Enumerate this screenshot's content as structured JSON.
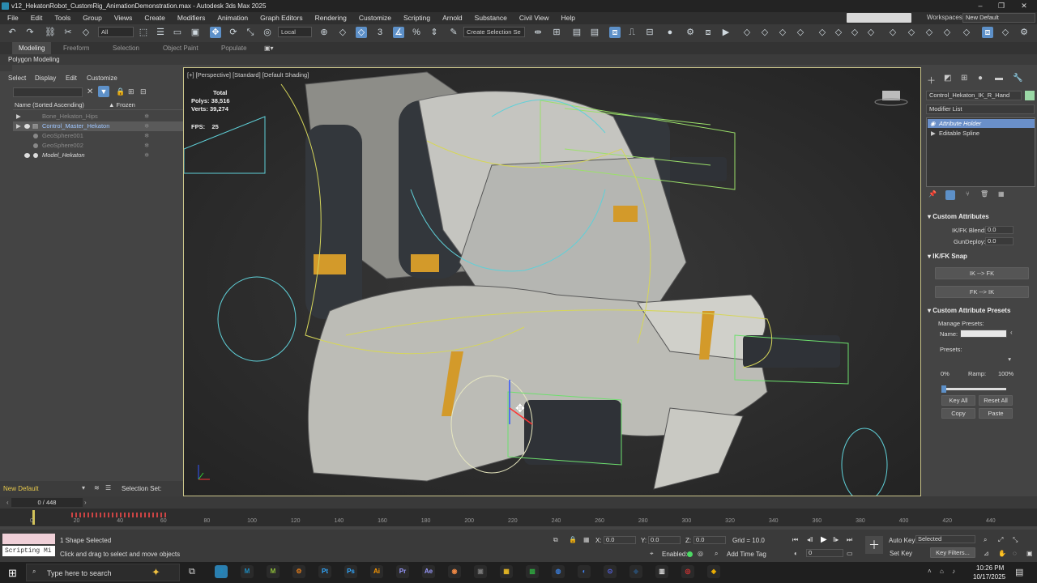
{
  "window": {
    "title": "v12_HekatonRobot_CustomRig_AnimationDemonstration.max - Autodesk 3ds Max 2025",
    "min": "–",
    "max": "❐",
    "close": "✕"
  },
  "menu": [
    "File",
    "Edit",
    "Tools",
    "Group",
    "Views",
    "Create",
    "Modifiers",
    "Animation",
    "Graph Editors",
    "Rendering",
    "Customize",
    "Scripting",
    "Arnold",
    "Substance",
    "Civil View",
    "Help"
  ],
  "workspace": {
    "label": "Workspaces:",
    "value": "New Default"
  },
  "toolbar": {
    "filter": "All",
    "coord": "Local",
    "selection_set": "Create Selection Se",
    "icons": {
      "undo": "↶",
      "redo": "↷",
      "link": "⛓",
      "unlink": "✂",
      "select": "⬚",
      "select_by_name": "☰",
      "rect_select": "▭",
      "window_cross": "▣",
      "move": "✥",
      "rotate": "⟳",
      "scale": "⤡",
      "place": "◎",
      "pivot": "⊕",
      "snap3": "3",
      "angle_snap": "∡",
      "percent_snap": "%",
      "spinner_snap": "⇕",
      "named_sel": "✎",
      "mirror": "⇹",
      "align": "⊞",
      "layer": "▤",
      "graph": "⎍",
      "schematic": "⊟",
      "material": "●",
      "render_setup": "⚙",
      "render": "▶",
      "frame": "⧈",
      "other": "◇"
    }
  },
  "ribbon": {
    "tabs": [
      "Modeling",
      "Freeform",
      "Selection",
      "Object Paint",
      "Populate"
    ],
    "active": "Modeling",
    "sub": "Polygon Modeling"
  },
  "scene_explorer": {
    "menu": [
      "Select",
      "Display",
      "Edit",
      "Customize"
    ],
    "header": {
      "name": "Name (Sorted Ascending)",
      "frozen": "▲ Frozen"
    },
    "items": [
      {
        "name": "Bone_Hekaton_Hips",
        "style": "dim"
      },
      {
        "name": "Control_Master_Hekaton",
        "style": "blue"
      },
      {
        "name": "GeoSphere001",
        "style": "dim"
      },
      {
        "name": "GeoSphere002",
        "style": "dim"
      },
      {
        "name": "Model_Hekaton",
        "style": "italic"
      }
    ]
  },
  "viewport": {
    "label": "[+] [Perspective] [Standard] [Default Shading]",
    "stats": {
      "total": "Total",
      "polys_label": "Polys:",
      "polys": "38,516",
      "verts_label": "Verts:",
      "verts": "39,274",
      "fps_label": "FPS:",
      "fps": "25"
    }
  },
  "command_panel": {
    "object_name": "Control_Hekaton_IK_R_Hand",
    "object_color": "#9bd8a6",
    "modifier_list": "Modifier List",
    "stack": [
      {
        "name": "Attribute Holder",
        "selected": true
      },
      {
        "name": "Editable Spline",
        "selected": false
      }
    ],
    "rollouts": {
      "custom_attributes": {
        "title": "Custom Attributes",
        "ikfk_label": "IK/FK Blend:",
        "ikfk_value": "0.0",
        "gundeploy_label": "GunDeploy:",
        "gundeploy_value": "0.0"
      },
      "ikfk_snap": {
        "title": "IK/FK Snap",
        "btn1": "IK --> FK",
        "btn2": "FK --> IK"
      },
      "presets": {
        "title": "Custom Attribute Presets",
        "manage": "Manage Presets:",
        "name_label": "Name:",
        "name_value": "",
        "presets_label": "Presets:",
        "ramp_min": "0%",
        "ramp_label": "Ramp:",
        "ramp_max": "100%",
        "ramp_value": 0,
        "key_all": "Key All",
        "reset_all": "Reset All",
        "copy": "Copy",
        "paste": "Paste"
      }
    }
  },
  "layer": {
    "name": "New Default",
    "selection_set": "Selection Set:"
  },
  "time": {
    "frame": "0 / 448",
    "ticks": [
      "0",
      "20",
      "40",
      "60",
      "80",
      "100",
      "120",
      "140",
      "160",
      "180",
      "200",
      "220",
      "240",
      "260",
      "280",
      "300",
      "320",
      "340",
      "360",
      "380",
      "400",
      "420",
      "440"
    ]
  },
  "status": {
    "maxscript": "Scripting Mi",
    "selected": "1 Shape Selected",
    "prompt": "Click and drag to select and move objects",
    "x_label": "X:",
    "x": "0.0",
    "y_label": "Y:",
    "y": "0.0",
    "z_label": "Z:",
    "z": "0.0",
    "grid": "Grid = 10.0",
    "enabled": "Enabled:",
    "add_time_tag": "Add Time Tag",
    "autokey": "Auto Key",
    "setkey": "Set Key",
    "selected_dd": "Selected",
    "key_filters": "Key Filters...",
    "frame_field": "0"
  },
  "taskbar": {
    "search": "Type here to search",
    "time": "10:26 PM",
    "date": "10/17/2025",
    "apps": [
      "3",
      "M",
      "M",
      "⚙",
      "Pt",
      "Ps",
      "Ai",
      "Pr",
      "Ae",
      "◉",
      "▣",
      "▦",
      "▩",
      "◍",
      "◐",
      "⊙",
      "◆",
      "▥",
      "◎",
      "◈"
    ]
  },
  "colors": {
    "accent": "#5d90c8",
    "selection_blue": "#6a8fc8",
    "viewport_border": "#c9c48a"
  }
}
